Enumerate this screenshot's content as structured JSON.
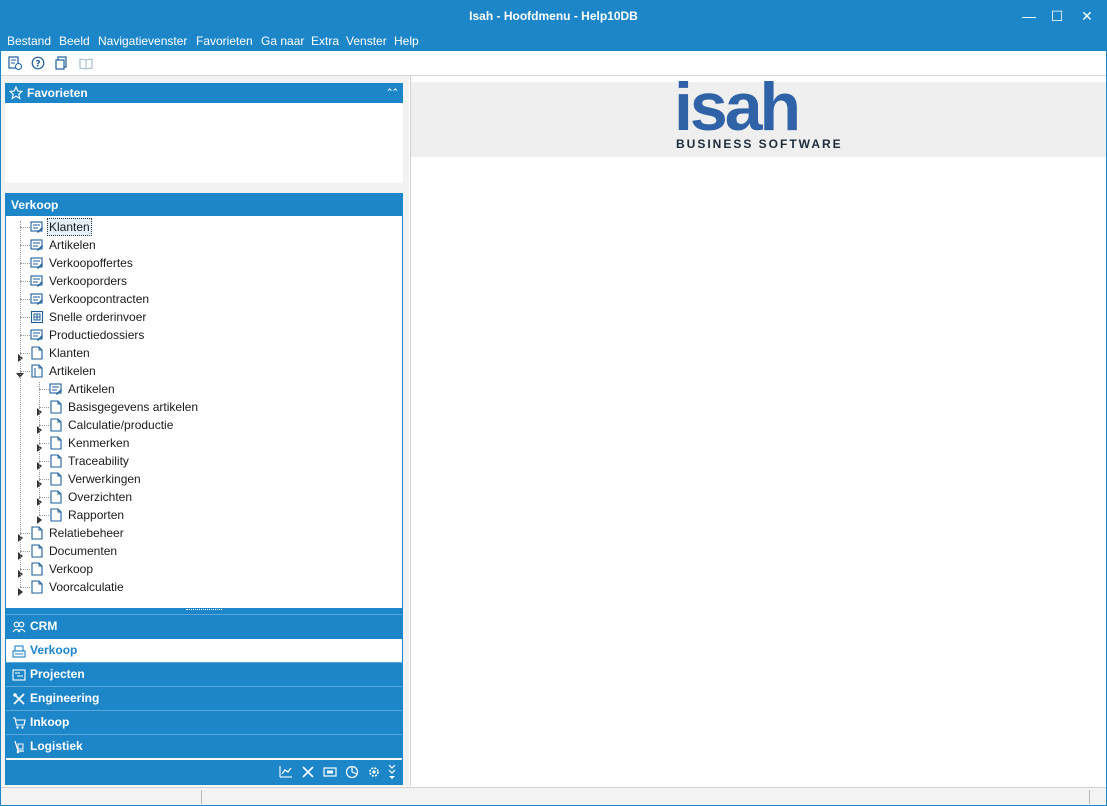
{
  "window": {
    "title": "Isah - Hoofdmenu - Help10DB",
    "minimize_glyph": "—",
    "maximize_glyph": "☐",
    "close_glyph": "✕"
  },
  "menu": [
    "Bestand",
    "Beeld",
    "Navigatievenster",
    "Favorieten",
    "Ga naar",
    "Extra",
    "Venster",
    "Help"
  ],
  "toolbar_icons": [
    "list-clock-icon",
    "help-icon",
    "copy-doc-icon",
    "book-icon"
  ],
  "favorites": {
    "title": "Favorieten",
    "collapse_glyph": "⌃⌃"
  },
  "navigator": {
    "title": "Verkoop",
    "tree": [
      {
        "label": "Klanten",
        "icon": "form-icon",
        "level": 0,
        "expander": "none",
        "selected": true
      },
      {
        "label": "Artikelen",
        "icon": "form-icon",
        "level": 0,
        "expander": "none"
      },
      {
        "label": "Verkoopoffertes",
        "icon": "form-icon",
        "level": 0,
        "expander": "none"
      },
      {
        "label": "Verkooporders",
        "icon": "form-icon",
        "level": 0,
        "expander": "none"
      },
      {
        "label": "Verkoopcontracten",
        "icon": "form-icon",
        "level": 0,
        "expander": "none"
      },
      {
        "label": "Snelle orderinvoer",
        "icon": "quick-entry-icon",
        "level": 0,
        "expander": "none"
      },
      {
        "label": "Productiedossiers",
        "icon": "form-icon",
        "level": 0,
        "expander": "none"
      },
      {
        "label": "Klanten",
        "icon": "folder-page-icon",
        "level": 0,
        "expander": "collapsed"
      },
      {
        "label": "Artikelen",
        "icon": "folder-open-icon",
        "level": 0,
        "expander": "expanded"
      },
      {
        "label": "Artikelen",
        "icon": "form-icon",
        "level": 1,
        "expander": "none"
      },
      {
        "label": "Basisgegevens artikelen",
        "icon": "folder-page-icon",
        "level": 1,
        "expander": "collapsed"
      },
      {
        "label": "Calculatie/productie",
        "icon": "folder-page-icon",
        "level": 1,
        "expander": "collapsed"
      },
      {
        "label": "Kenmerken",
        "icon": "folder-page-icon",
        "level": 1,
        "expander": "collapsed"
      },
      {
        "label": "Traceability",
        "icon": "folder-page-icon",
        "level": 1,
        "expander": "collapsed"
      },
      {
        "label": "Verwerkingen",
        "icon": "folder-page-icon",
        "level": 1,
        "expander": "collapsed"
      },
      {
        "label": "Overzichten",
        "icon": "folder-page-icon",
        "level": 1,
        "expander": "collapsed"
      },
      {
        "label": "Rapporten",
        "icon": "folder-page-icon",
        "level": 1,
        "expander": "collapsed"
      },
      {
        "label": "Relatiebeheer",
        "icon": "folder-page-icon",
        "level": 0,
        "expander": "collapsed"
      },
      {
        "label": "Documenten",
        "icon": "folder-page-icon",
        "level": 0,
        "expander": "collapsed"
      },
      {
        "label": "Verkoop",
        "icon": "folder-page-icon",
        "level": 0,
        "expander": "collapsed"
      },
      {
        "label": "Voorcalculatie",
        "icon": "folder-page-icon",
        "level": 0,
        "expander": "collapsed"
      }
    ]
  },
  "modules": [
    {
      "label": "CRM",
      "icon": "people-icon",
      "active": false
    },
    {
      "label": "Verkoop",
      "icon": "register-icon",
      "active": true
    },
    {
      "label": "Projecten",
      "icon": "project-board-icon",
      "active": false
    },
    {
      "label": "Engineering",
      "icon": "tools-cross-icon",
      "active": false
    },
    {
      "label": "Inkoop",
      "icon": "cart-icon",
      "active": false
    },
    {
      "label": "Logistiek",
      "icon": "hand-truck-icon",
      "active": false
    }
  ],
  "module_bar_icons": [
    "chart-line-icon",
    "tools-icon",
    "monitor-icon",
    "pie-chart-icon",
    "gear-icon",
    "more-chevron-icon"
  ],
  "logo": {
    "word": "isah",
    "tagline": "BUSINESS SOFTWARE"
  },
  "colors": {
    "accent": "#1c86c9",
    "logo_blue": "#2f62a7",
    "logo_dark": "#1d2b3a"
  }
}
